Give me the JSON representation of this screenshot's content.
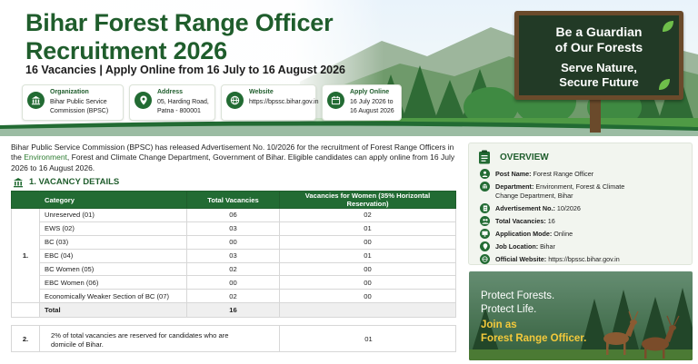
{
  "header": {
    "title_line1": "Bihar Forest Range Officer",
    "title_line2": "Recruitment 2026",
    "subtitle": "16 Vacancies | Apply Online from 16 July to 16 August 2026",
    "cards": [
      {
        "label": "Organization",
        "value_line1": "Bihar Public Service",
        "value_line2": "Commission (BPSC)",
        "icon": "building-icon"
      },
      {
        "label": "Address",
        "value_line1": "05, Harding Road,",
        "value_line2": "Patna - 800001",
        "icon": "location-pin-icon"
      },
      {
        "label": "Website",
        "value_line1": "https://bpssc.bihar.gov.in",
        "value_line2": "",
        "icon": "globe-icon"
      },
      {
        "label": "Apply Online",
        "value_line1": "16 July 2026 to",
        "value_line2": "16 August 2026",
        "icon": "calendar-icon"
      }
    ],
    "sign": {
      "line1": "Be a Guardian",
      "line2": "of Our Forests",
      "line3": "Serve Nature,",
      "line4": "Secure Future"
    }
  },
  "intro": {
    "part1": "Bihar Public Service Commission (BPSC) has released Advertisement No. 10/2026 for the recruitment of Forest Range Officers in the ",
    "highlight": "Environment",
    "part2": ", Forest and Climate Change Department, Government of Bihar. Eligible candidates can apply online from 16 July 2026 to 16 August 2026."
  },
  "vacancy": {
    "heading": "1. VACANCY DETAILS",
    "columns": [
      "Category",
      "Total Vacancies",
      "Vacancies for Women (35% Horizontal Reservation)"
    ],
    "serial": "1.",
    "rows": [
      {
        "category": "Unreserved (01)",
        "total": "06",
        "women": "02"
      },
      {
        "category": "EWS (02)",
        "total": "03",
        "women": "01"
      },
      {
        "category": "BC (03)",
        "total": "00",
        "women": "00"
      },
      {
        "category": "EBC (04)",
        "total": "03",
        "women": "01"
      },
      {
        "category": "BC Women (05)",
        "total": "02",
        "women": "00"
      },
      {
        "category": "EBC Women (06)",
        "total": "00",
        "women": "00"
      },
      {
        "category": "Economically Weaker Section of BC (07)",
        "total": "02",
        "women": "00"
      }
    ],
    "total_label": "Total",
    "total_value": "16",
    "row2": {
      "serial": "2.",
      "text": "2% of total vacancies are reserved for candidates who are domicile of Bihar.",
      "value": "01"
    }
  },
  "overview": {
    "heading": "OVERVIEW",
    "items": [
      {
        "key": "Post Name:",
        "value": "Forest Range Officer",
        "icon": "user-icon"
      },
      {
        "key": "Department:",
        "value": "Environment, Forest & Climate Change Department, Bihar",
        "icon": "building-icon"
      },
      {
        "key": "Advertisement No.:",
        "value": "10/2026",
        "icon": "document-icon"
      },
      {
        "key": "Total Vacancies:",
        "value": "16",
        "icon": "people-icon"
      },
      {
        "key": "Application Mode:",
        "value": "Online",
        "icon": "monitor-icon"
      },
      {
        "key": "Job Location:",
        "value": "Bihar",
        "icon": "location-pin-icon"
      },
      {
        "key": "Official Website:",
        "value": "https://bpssc.bihar.gov.in",
        "icon": "globe-icon"
      }
    ]
  },
  "promo": {
    "line1": "Protect Forests.",
    "line2": "Protect Life.",
    "line3": "Join as",
    "line4": "Forest Range Officer."
  },
  "colors": {
    "primary_green": "#226b33",
    "title_green": "#1f5d2c",
    "accent_yellow": "#f3c93b",
    "sign_board": "#223a26"
  }
}
